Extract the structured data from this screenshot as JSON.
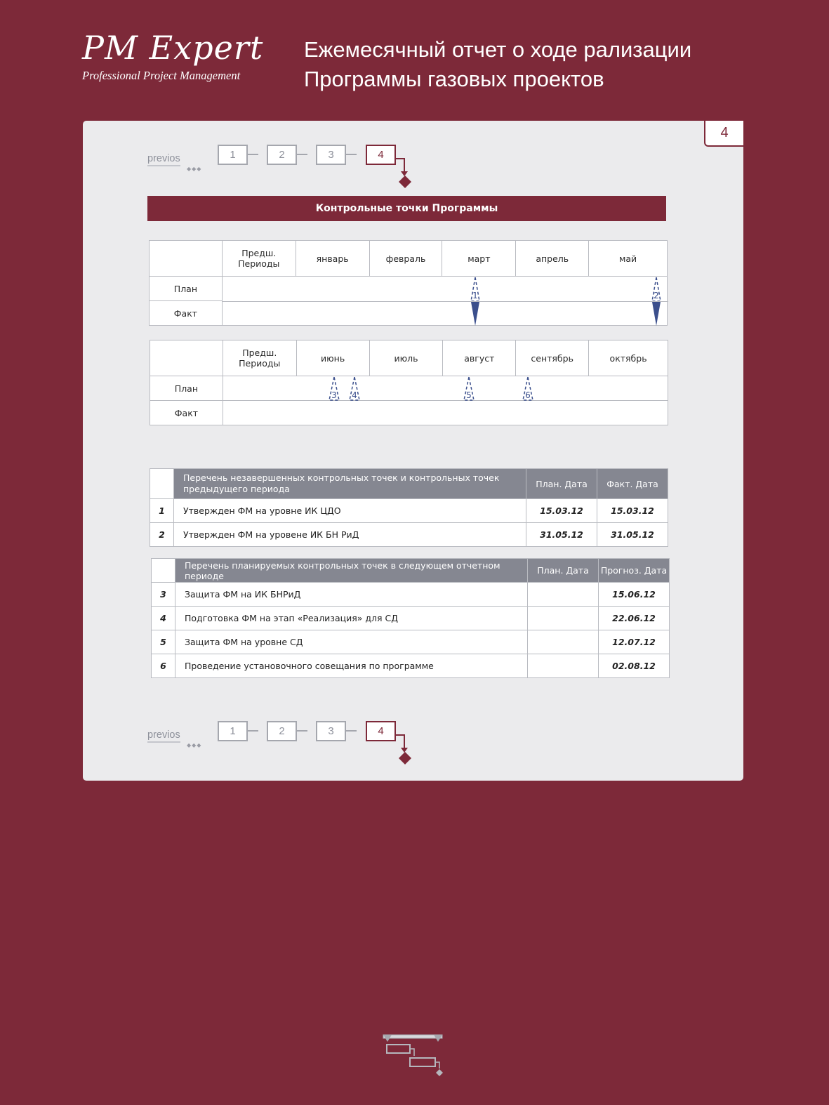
{
  "brand": {
    "name": "PM Expert",
    "tagline": "Professional Project Management"
  },
  "report": {
    "title_line1": "Ежемесячный отчет о ходе рализации",
    "title_line2": "Программы газовых проектов"
  },
  "page_number": "4",
  "pager": {
    "prev_label": "previos",
    "dots": "◆◆◆",
    "pages": [
      "1",
      "2",
      "3",
      "4"
    ],
    "active": "4"
  },
  "section_title": "Контрольные точки Программы",
  "gantt_top": {
    "prev_periods_line1": "Предш.",
    "prev_periods_line2": "Периоды",
    "months": [
      "январь",
      "февраль",
      "март",
      "апрель",
      "май"
    ],
    "plan_label": "План",
    "fact_label": "Факт",
    "plan_markers": [
      "1",
      "2"
    ]
  },
  "gantt_bottom": {
    "prev_periods_line1": "Предш.",
    "prev_periods_line2": "Периоды",
    "months": [
      "июнь",
      "июль",
      "август",
      "сентябрь",
      "октябрь"
    ],
    "plan_label": "План",
    "fact_label": "Факт",
    "plan_markers": [
      "3",
      "4",
      "5",
      "6"
    ]
  },
  "incomplete_table": {
    "header_line1": "Перечень незавершенных контрольных точек и контрольных точек",
    "header_line2": "предыдущего периода",
    "col_plan": "План. Дата",
    "col_fact": "Факт. Дата",
    "rows": [
      {
        "num": "1",
        "text": "Утвержден ФМ на уровне ИК ЦДО",
        "plan": "15.03.12",
        "fact": "15.03.12"
      },
      {
        "num": "2",
        "text": "Утвержден ФМ на уровене ИК БН РиД",
        "plan": "31.05.12",
        "fact": "31.05.12"
      }
    ]
  },
  "planned_table": {
    "header": "Перечень планируемых контрольных точек в следующем отчетном периоде",
    "col_plan": "План. Дата",
    "col_forecast": "Прогноз. Дата",
    "rows": [
      {
        "num": "3",
        "text": "Защита ФМ на ИК БНРиД",
        "plan": "",
        "forecast": "15.06.12"
      },
      {
        "num": "4",
        "text": "Подготовка ФМ на этап «Реализация» для СД",
        "plan": "",
        "forecast": "22.06.12"
      },
      {
        "num": "5",
        "text": "Защита ФМ на уровне СД",
        "plan": "",
        "forecast": "12.07.12"
      },
      {
        "num": "6",
        "text": "Проведение установочного совещания по программе",
        "plan": "",
        "forecast": "02.08.12"
      }
    ]
  },
  "colors": {
    "brand": "#7d2939",
    "panel": "#ebebed",
    "header_gray": "#858791",
    "marker_blue": "#3b4f8c"
  }
}
